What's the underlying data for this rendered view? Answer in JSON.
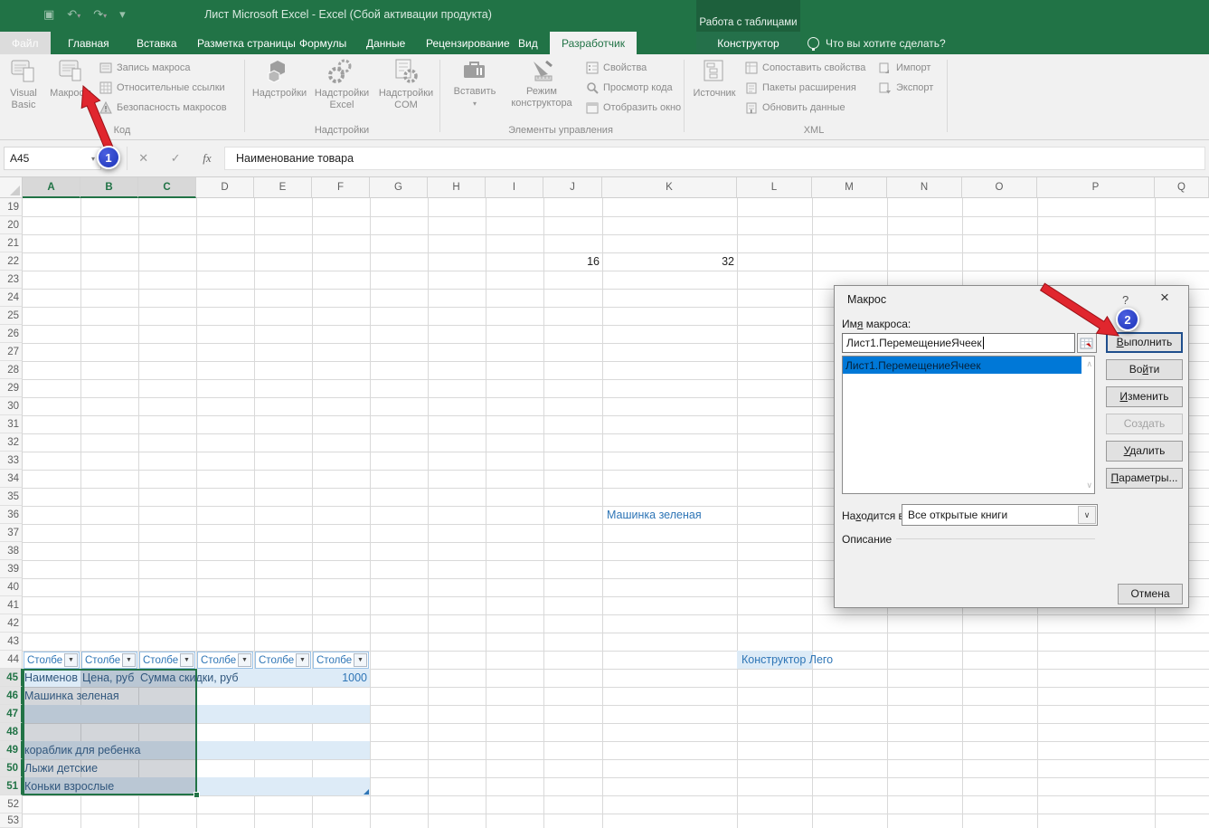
{
  "title_bar": {
    "title": "Лист Microsoft Excel - Excel (Сбой активации продукта)",
    "contextual_label": "Работа с таблицами"
  },
  "tabs": [
    "Файл",
    "Главная",
    "Вставка",
    "Разметка страницы",
    "Формулы",
    "Данные",
    "Рецензирование",
    "Вид",
    "Разработчик",
    "Конструктор"
  ],
  "tell_me": "Что вы хотите сделать?",
  "ribbon": {
    "vb": "Visual Basic",
    "macros": "Макросы",
    "record_macro": "Запись макроса",
    "relative_refs": "Относительные ссылки",
    "macro_security": "Безопасность макросов",
    "addins": "Надстройки",
    "excel_addins": "Надстройки Excel",
    "com_addins": "Надстройки COM",
    "insert": "Вставить",
    "design_mode": "Режим конструктора",
    "properties": "Свойства",
    "view_code": "Просмотр кода",
    "show_window": "Отобразить окно",
    "source": "Источник",
    "map_properties": "Сопоставить свойства",
    "expansion_packs": "Пакеты расширения",
    "refresh_data": "Обновить данные",
    "import": "Импорт",
    "export": "Экспорт",
    "groups": [
      {
        "label": "Код"
      },
      {
        "label": "Надстройки"
      },
      {
        "label": "Элементы управления"
      },
      {
        "label": "XML"
      }
    ]
  },
  "formula_bar": {
    "name_box": "A45",
    "formula": "Наименование товара",
    "fx_label": "fx",
    "cancel_glyph": "✕",
    "enter_glyph": "✓"
  },
  "grid": {
    "col_letters": [
      "A",
      "B",
      "C",
      "D",
      "E",
      "F",
      "G",
      "H",
      "I",
      "J",
      "K",
      "L",
      "M",
      "N",
      "O",
      "P",
      "Q"
    ],
    "row_numbers": [
      19,
      20,
      21,
      22,
      23,
      24,
      25,
      26,
      27,
      28,
      29,
      30,
      31,
      32,
      33,
      34,
      35,
      36,
      37,
      38,
      39,
      40,
      41,
      42,
      43,
      44,
      45,
      46,
      47,
      48,
      49,
      50,
      51,
      52,
      53
    ],
    "selected_columns": [
      "A",
      "B",
      "C"
    ],
    "selected_rows": [
      45,
      46,
      47,
      48,
      49,
      50,
      51
    ]
  },
  "sheet": {
    "table_header": "Столбе",
    "filter_icon": "▼",
    "cells": {
      "J22": "16",
      "K22": "32",
      "J36": "Машинка зеленая",
      "L44": "Конструктор Лего",
      "A45": "Наименов",
      "B45": "Цена, руб",
      "C45": "Сумма скидки, руб",
      "F45": "1000",
      "A46": "Машинка зеленая",
      "A49": "кораблик для ребенка",
      "A50": "Лыжи детские",
      "A51": "Коньки взрослые"
    }
  },
  "dialog": {
    "title": "Макрос",
    "help_icon": "?",
    "close_icon": "×",
    "name_label": "Им<u>я</u> макроса:",
    "name_value": "Лист1.ПеремещениеЯчеек",
    "list_items": [
      "Лист1.ПеремещениеЯчеек"
    ],
    "run_btn": "<u>В</u>ыполнить",
    "step_btn": "Во<u>й</u>ти",
    "edit_btn": "<u>И</u>зменить",
    "create_btn": "Создать",
    "delete_btn": "<u>У</u>далить",
    "options_btn": "<u>П</u>араметры...",
    "cancel_btn": "Отмена",
    "location_label": "На<u>х</u>одится в:",
    "location_value": "Все открытые книги",
    "description_label": "Описание"
  },
  "annotations": {
    "step1": "1",
    "step2": "2"
  },
  "colors": {
    "excel_green": "#217346",
    "table_blue": "#2e75b6",
    "banding_blue": "#ddebf7",
    "badge_blue": "#2740c8",
    "arrow_red": "#e0262e",
    "list_selection": "#0078d7"
  }
}
